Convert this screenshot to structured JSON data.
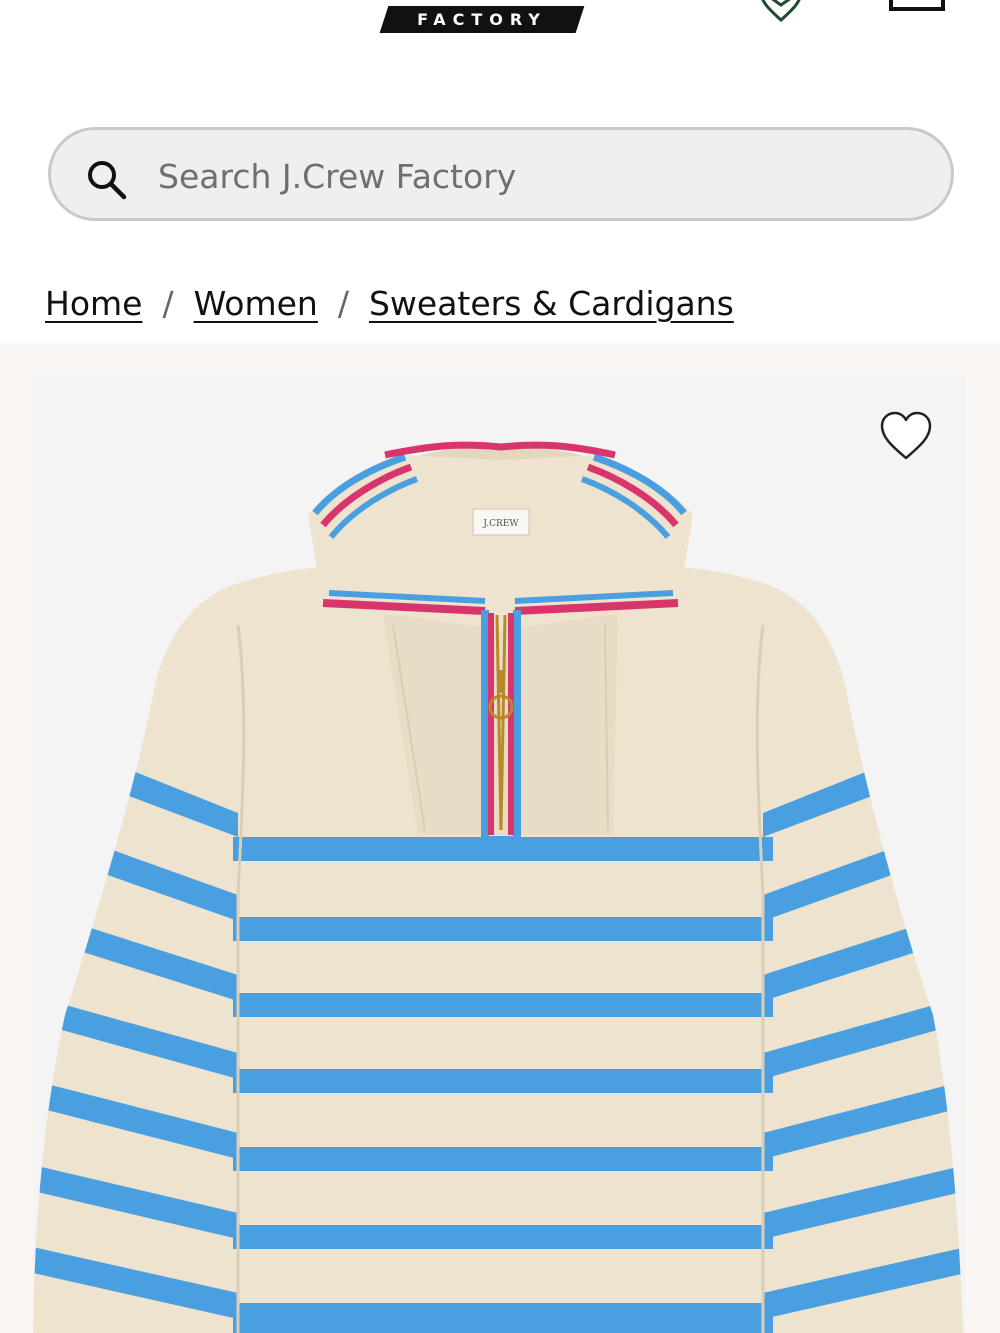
{
  "header": {
    "logo_text": "FACTORY",
    "store_icon": "location-pin-icon",
    "bag_icon": "shopping-bag-icon"
  },
  "search": {
    "placeholder": "Search J.Crew Factory",
    "icon": "search-icon"
  },
  "breadcrumb": {
    "items": [
      {
        "label": "Home"
      },
      {
        "label": "Women"
      },
      {
        "label": "Sweaters & Cardigans"
      }
    ],
    "separator": "/"
  },
  "product": {
    "label_text": "J.CREW",
    "wishlist_icon": "heart-icon"
  },
  "colors": {
    "cream": "#ede3cf",
    "stripe_blue": "#4a9fe0",
    "trim_pink": "#d9356c",
    "zipper_gold": "#b8892b",
    "store_green": "#1f4a2e"
  }
}
